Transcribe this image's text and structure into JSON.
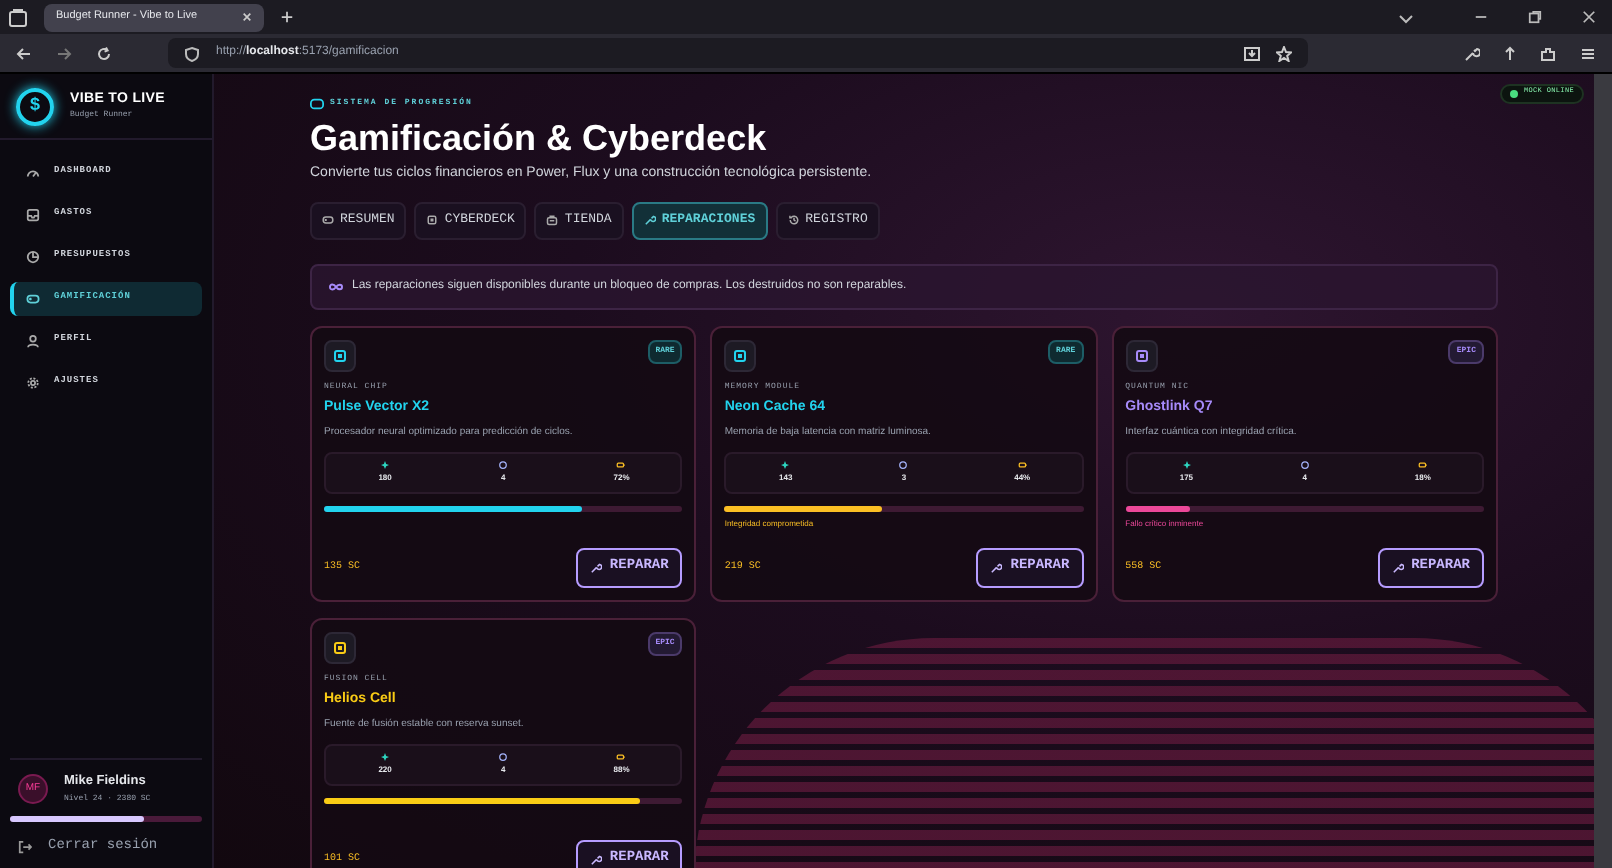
{
  "browser": {
    "tab_title": "Budget Runner - Vibe to Live",
    "url_prefix": "http://",
    "url_host": "localhost",
    "url_rest": ":5173/gamificacion"
  },
  "sidebar": {
    "logo_symbol": "$",
    "brand": "VIBE TO LIVE",
    "subtitle": "Budget Runner",
    "items": [
      {
        "label": "DASHBOARD",
        "selected": false
      },
      {
        "label": "GASTOS",
        "selected": false
      },
      {
        "label": "PRESUPUESTOS",
        "selected": false
      },
      {
        "label": "GAMIFICACIÓN",
        "selected": true
      },
      {
        "label": "PERFIL",
        "selected": false
      },
      {
        "label": "AJUSTES",
        "selected": false
      }
    ],
    "user": {
      "initials": "MF",
      "name": "Mike Fieldins",
      "detail": "Nivel 24 · 2380 SC",
      "level": 0.7
    },
    "logout": "Cerrar sesión"
  },
  "status_badge": "MOCK ONLINE",
  "header": {
    "eyebrow": "SISTEMA DE PROGRESIÓN",
    "title": "Gamificación & Cyberdeck",
    "subtitle": "Convierte tus ciclos financieros en Power, Flux y una construcción tecnológica persistente."
  },
  "tabs": [
    {
      "label": "RESUMEN",
      "selected": false
    },
    {
      "label": "CYBERDECK",
      "selected": false
    },
    {
      "label": "TIENDA",
      "selected": false
    },
    {
      "label": "REPARACIONES",
      "selected": true
    },
    {
      "label": "REGISTRO",
      "selected": false
    }
  ],
  "notice": "Las reparaciones siguen disponibles durante un bloqueo de compras. Los destruidos no son reparables.",
  "cards": [
    {
      "kind": "healthy",
      "rarity": "RARE",
      "type": "NEURAL CHIP",
      "name": "Pulse Vector X2",
      "color": "#22d3ee",
      "description": "Procesador neural optimizado para predicción de ciclos.",
      "stats": [
        "180",
        "4",
        "72%"
      ],
      "level": 0.72,
      "price": "135 SC",
      "button": "REPARAR"
    },
    {
      "kind": "warning",
      "rarity": "RARE",
      "type": "MEMORY MODULE",
      "name": "Neon Cache 64",
      "color": "#22d3ee",
      "description": "Memoria de baja latencia con matriz luminosa.",
      "stats": [
        "143",
        "3",
        "44%"
      ],
      "level": 0.44,
      "status": "Integridad comprometida",
      "price": "219 SC",
      "button": "REPARAR"
    },
    {
      "kind": "critical",
      "rarity": "EPIC",
      "type": "QUANTUM NIC",
      "name": "Ghostlink Q7",
      "color": "#a78bfa",
      "description": "Interfaz cuántica con integridad crítica.",
      "stats": [
        "175",
        "4",
        "18%"
      ],
      "level": 0.18,
      "status": "Fallo crítico inminente",
      "price": "558 SC",
      "button": "REPARAR"
    },
    {
      "kind": "healthy",
      "rarity": "EPIC",
      "type": "FUSION CELL",
      "name": "Helios Cell",
      "color": "#facc15",
      "description": "Fuente de fusión estable con reserva sunset.",
      "stats": [
        "220",
        "4",
        "88%"
      ],
      "level": 0.88,
      "price": "101 SC",
      "button": "REPARAR"
    }
  ]
}
